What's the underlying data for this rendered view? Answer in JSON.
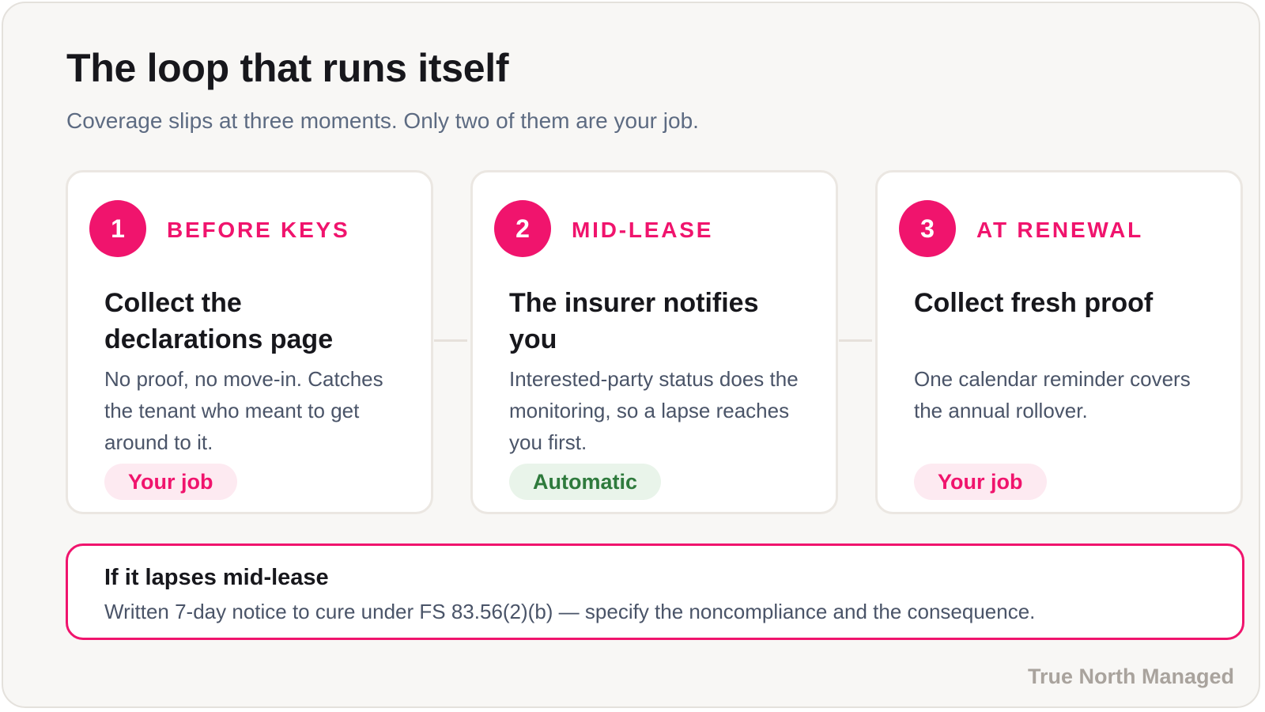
{
  "header": {
    "title": "The loop that runs itself",
    "subtitle": "Coverage slips at three moments. Only two of them are your job."
  },
  "steps": [
    {
      "number": "1",
      "kicker": "BEFORE KEYS",
      "title": "Collect the declarations page",
      "description": "No proof, no move-in. Catches the tenant who meant to get around to it.",
      "tag": "Your job"
    },
    {
      "number": "2",
      "kicker": "MID-LEASE",
      "title": "The insurer notifies you",
      "description": "Interested-party status does the monitoring, so a lapse reaches you first.",
      "tag": "Automatic"
    },
    {
      "number": "3",
      "kicker": "AT RENEWAL",
      "title": "Collect fresh proof",
      "description": "One calendar reminder covers the annual rollover.",
      "tag": "Your job"
    }
  ],
  "callout": {
    "title": "If it lapses mid-lease",
    "body": "Written 7-day notice to cure under FS 83.56(2)(b) — specify the noncompliance and the consequence."
  },
  "footer": {
    "brand": "True North Managed"
  },
  "colors": {
    "accent": "#f0146d",
    "automatic": "#2e7a3c",
    "automatic_bg": "#e9f4ea",
    "your_job_bg": "#fdeaf1"
  }
}
